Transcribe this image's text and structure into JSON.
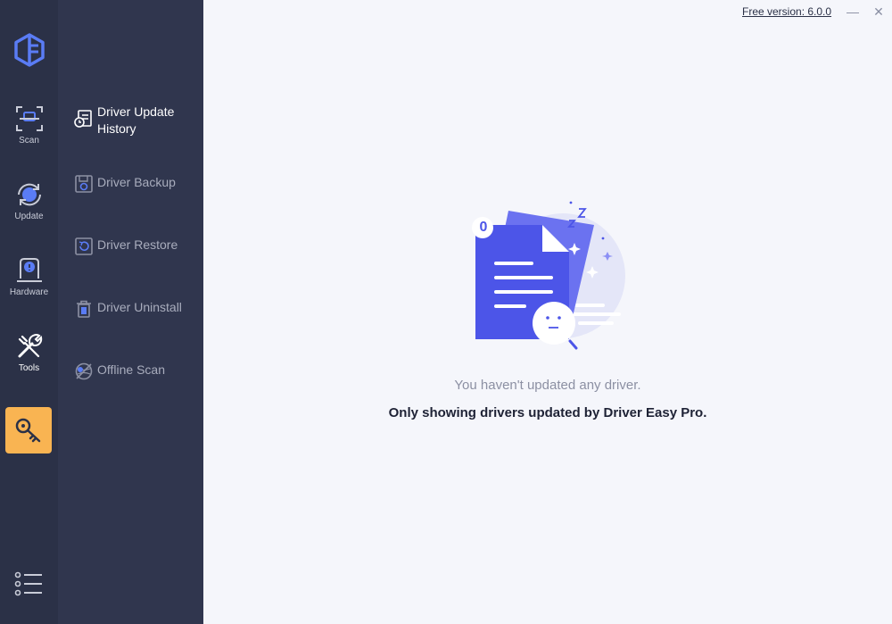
{
  "app": {
    "version_label": "Free version: 6.0.0"
  },
  "window": {
    "minimize_glyph": "—",
    "close_glyph": "✕"
  },
  "rail": {
    "items": [
      {
        "label": "Scan",
        "icon": "scan-icon"
      },
      {
        "label": "Update",
        "icon": "update-icon"
      },
      {
        "label": "Hardware",
        "icon": "hardware-icon"
      },
      {
        "label": "Tools",
        "icon": "tools-icon"
      }
    ],
    "key_icon": "key-icon",
    "menu_icon": "list-menu-icon"
  },
  "submenu": {
    "items": [
      {
        "label": "Driver Update History",
        "icon": "history-icon",
        "active": true
      },
      {
        "label": "Driver Backup",
        "icon": "backup-icon"
      },
      {
        "label": "Driver Restore",
        "icon": "restore-icon"
      },
      {
        "label": "Driver Uninstall",
        "icon": "trash-icon"
      },
      {
        "label": "Offline Scan",
        "icon": "offline-scan-icon"
      }
    ]
  },
  "empty_state": {
    "illustration_badge": "0",
    "message": "You haven't updated any driver.",
    "note": "Only showing drivers updated by Driver Easy Pro."
  },
  "colors": {
    "accent": "#f9b452",
    "brand": "#4c55e8",
    "rail_bg": "#2b3147",
    "submenu_bg": "#30364e"
  }
}
